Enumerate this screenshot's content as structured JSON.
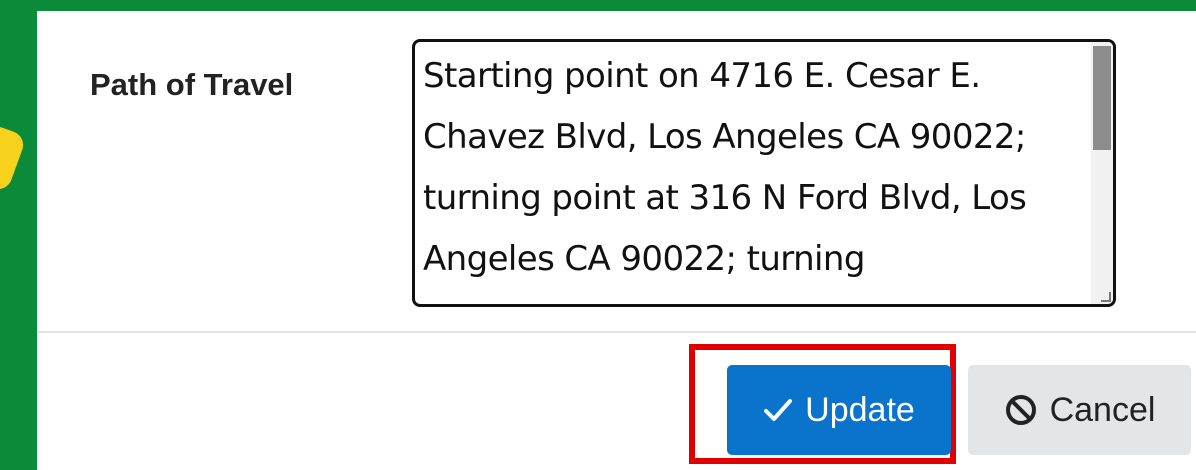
{
  "form": {
    "path_label": "Path of Travel",
    "path_value": "Starting point on 4716 E. Cesar E. Chavez Blvd, Los Angeles CA 90022; turning point at 316 N Ford Blvd, Los Angeles CA 90022; turning"
  },
  "actions": {
    "update_label": "Update",
    "update_icon": "check-icon",
    "cancel_label": "Cancel",
    "cancel_icon": "ban-icon"
  },
  "colors": {
    "background_green": "#0b8a3a",
    "update_button": "#0a74cc",
    "cancel_button": "#e4e5e7",
    "highlight_red": "#e10000",
    "marker_yellow": "#f7d21c"
  }
}
